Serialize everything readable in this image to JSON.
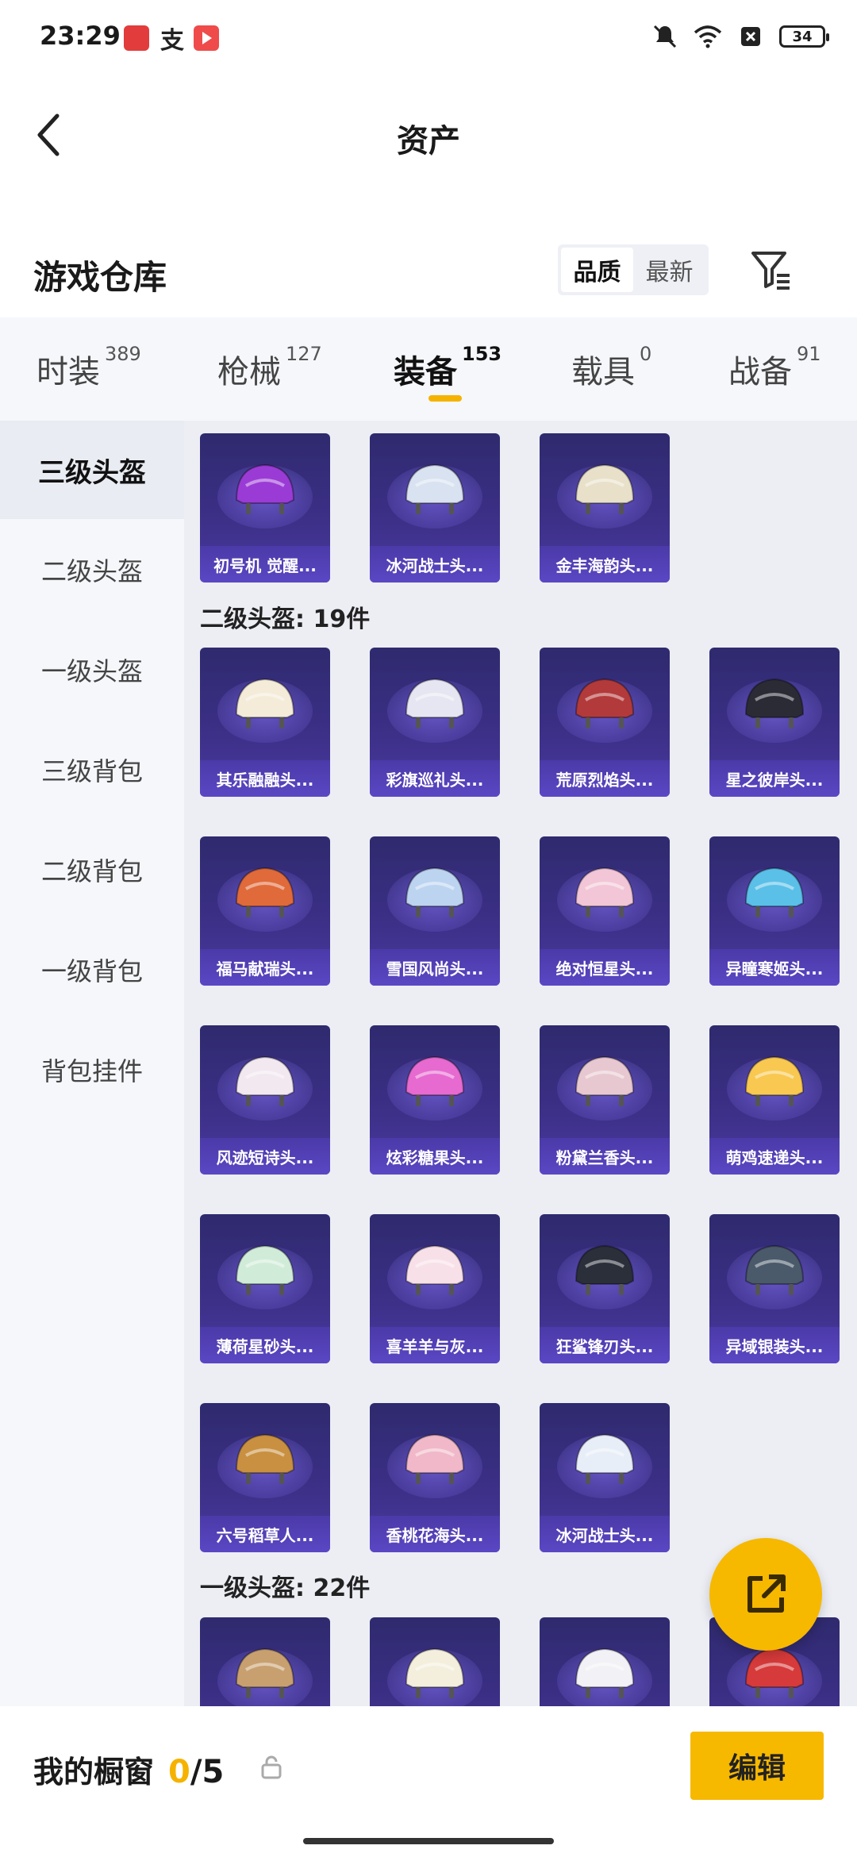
{
  "status_bar": {
    "time": "23:29",
    "app2_glyph": "支",
    "battery": "34"
  },
  "header": {
    "title": "资产"
  },
  "warehouse": {
    "title": "游戏仓库",
    "sort_quality": "品质",
    "sort_newest": "最新"
  },
  "tabs": [
    {
      "label": "时装",
      "count": "389"
    },
    {
      "label": "枪械",
      "count": "127"
    },
    {
      "label": "装备",
      "count": "153"
    },
    {
      "label": "载具",
      "count": "0"
    },
    {
      "label": "战备",
      "count": "91"
    }
  ],
  "sidebar": [
    {
      "label": "三级头盔"
    },
    {
      "label": "二级头盔"
    },
    {
      "label": "一级头盔"
    },
    {
      "label": "三级背包"
    },
    {
      "label": "二级背包"
    },
    {
      "label": "一级背包"
    },
    {
      "label": "背包挂件"
    }
  ],
  "sections": {
    "level2_title": "二级头盔: 19件",
    "level1_title": "一级头盔: 22件"
  },
  "items": {
    "level3": [
      "初号机 觉醒...",
      "冰河战士头...",
      "金丰海韵头..."
    ],
    "level2": [
      "其乐融融头...",
      "彩旗巡礼头...",
      "荒原烈焰头...",
      "星之彼岸头...",
      "福马献瑞头...",
      "雪国风尚头...",
      "绝对恒星头...",
      "异瞳寒姬头...",
      "风迹短诗头...",
      "炫彩糖果头...",
      "粉黛兰香头...",
      "萌鸡速递头...",
      "薄荷星砂头...",
      "喜羊羊与灰...",
      "狂鲨锋刃头...",
      "异域银装头...",
      "六号稻草人...",
      "香桃花海头...",
      "冰河战士头..."
    ]
  },
  "item_colors": {
    "level3": [
      "#9b3bd6",
      "#d8e2f0",
      "#e8e0c8"
    ],
    "level2": [
      "#f4ecd8",
      "#e6e6f2",
      "#b33a3a",
      "#2b2b35",
      "#e06a3a",
      "#bcd4f0",
      "#f2c6d6",
      "#5ac0e8",
      "#f2e8f0",
      "#e66ad0",
      "#e8c8d0",
      "#f8c850",
      "#d0ecd8",
      "#f8e0e8",
      "#2a2f3a",
      "#4a5a6a",
      "#c89040",
      "#f0b8c8",
      "#e8eef8"
    ],
    "level1": [
      "#c8a070",
      "#f4efdc",
      "#f2f2f6",
      "#d63a3a"
    ]
  },
  "bottom": {
    "showcase_label": "我的橱窗",
    "current": "0",
    "total": "/5",
    "edit_label": "编辑"
  }
}
